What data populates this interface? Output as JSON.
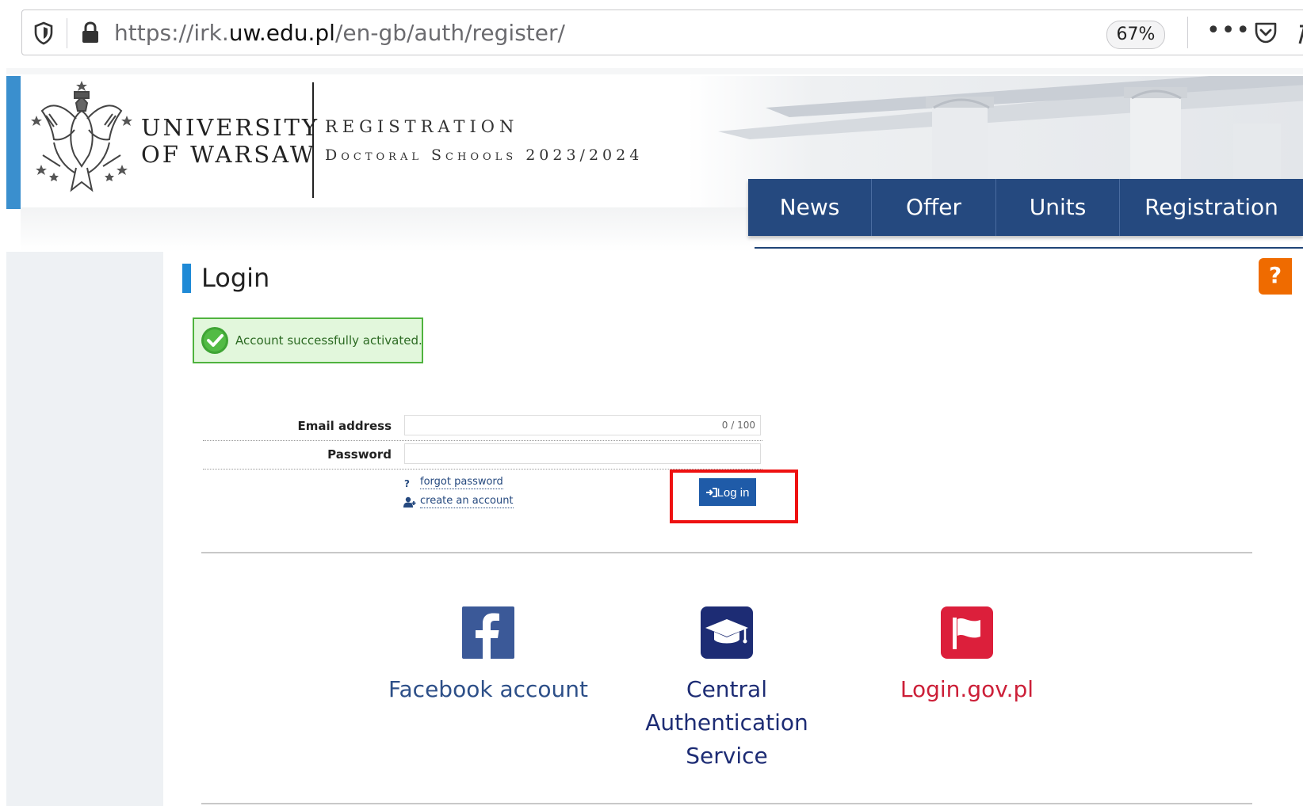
{
  "browser": {
    "url_prefix": "https://irk.",
    "url_host": "uw.edu.pl",
    "url_path": "/en-gb/auth/register/",
    "zoom": "67%",
    "more_label": "•••"
  },
  "header": {
    "university_line1": "UNIVERSITY",
    "university_line2": "OF WARSAW",
    "registration_title": "REGISTRATION",
    "registration_subtitle": "Doctoral Schools 2023/2024"
  },
  "nav": {
    "items": [
      {
        "label": "News"
      },
      {
        "label": "Offer"
      },
      {
        "label": "Units"
      },
      {
        "label": "Registration"
      }
    ]
  },
  "help": {
    "label": "?"
  },
  "login": {
    "title": "Login",
    "success_message": "Account successfully activated.",
    "email_label": "Email address",
    "email_value": "",
    "email_counter": "0 / 100",
    "password_label": "Password",
    "password_value": "",
    "forgot_password": "forgot password",
    "create_account": "create an account",
    "login_button": "Log in"
  },
  "alternatives": [
    {
      "label": "Facebook account",
      "icon": "facebook-icon",
      "color": "#3b5998"
    },
    {
      "label": "Central Authentication Service",
      "icon": "graduation-cap-icon",
      "color": "#1d2c74"
    },
    {
      "label": "Login.gov.pl",
      "icon": "flag-icon",
      "color": "#dc1f3b"
    }
  ],
  "colors": {
    "nav_bg": "#25497f",
    "accent_blue": "#1f8ad6",
    "help_orange": "#ef6b00",
    "success_green": "#4fb33e",
    "highlight_red": "#ee1111"
  }
}
